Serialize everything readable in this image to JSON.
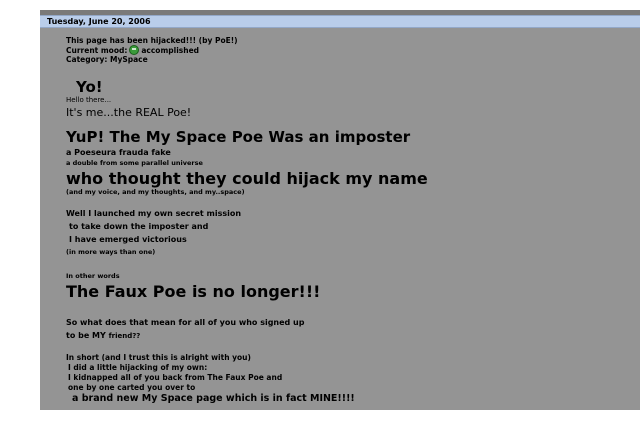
{
  "post": {
    "date": "Tuesday, June 20, 2006",
    "subject": "This page has been hijacked!!! (by PoE!)",
    "mood_label": "Current mood:",
    "mood_value": "accomplished",
    "mood_icon": "smiley-face-icon",
    "mood_icon_color": "#3a9a3a",
    "category_label": "Category:",
    "category_value": "MySpace"
  },
  "body": {
    "yo": "Yo!",
    "hello": "Hello there...",
    "real_poe": "It's me...the REAL Poe!",
    "imposter_heading": "YuP! The My Space Poe Was an imposter",
    "fraud_line": "a Poeseura frauda fake",
    "double_line": "a double from some parallel universe",
    "hijack_heading": "who thought they could hijack my name",
    "voice_line": "(and my voice, and my thoughts, and my..space)",
    "mission_1": "Well I launched my own secret mission",
    "mission_2": "to take down the imposter and",
    "mission_3": "I have emerged victorious",
    "more_ways": "(in more ways than one)",
    "other_words": "In other words",
    "faux_heading": "The Faux Poe is no longer!!!",
    "meaning_1": "So what does that mean for all of you who signed up",
    "meaning_2_main": "to be MY",
    "meaning_2_small": "friend??",
    "short_1": "In short (and I trust this is alright with you)",
    "short_2": "I did a little hijacking of my own:",
    "short_3": "I kidnapped all of you back from The Faux Poe and",
    "short_4": "one by one carted you over to",
    "short_5": "a brand new My Space page which is in fact MINE!!!!"
  },
  "colors": {
    "panel_bg": "#949494",
    "date_bar_bg": "#b9cdea",
    "top_rule": "#7a7a7a",
    "text": "#000000"
  }
}
